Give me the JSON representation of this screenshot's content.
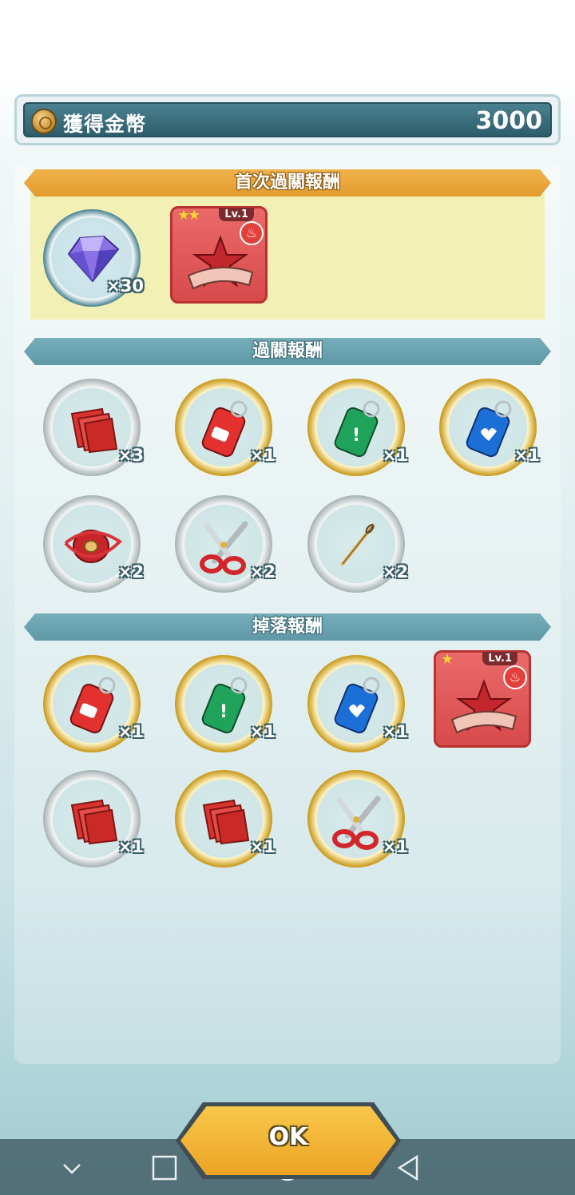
{
  "coin_bar": {
    "label": "獲得金幣",
    "value": "3000",
    "icon": "coin-icon"
  },
  "sections": {
    "first_clear": {
      "title": "首次過關報酬"
    },
    "clear": {
      "title": "過關報酬"
    },
    "drop": {
      "title": "掉落報酬"
    }
  },
  "first_clear_items": [
    {
      "icon": "diamond-icon",
      "qty": "×30"
    },
    {
      "icon": "red-star-scarf-card-icon",
      "stars": "★★",
      "level": "Lv.1"
    }
  ],
  "clear_items": [
    {
      "icon": "red-cloth-icon",
      "qty": "×3"
    },
    {
      "icon": "red-bottle-icon",
      "qty": "×1"
    },
    {
      "icon": "green-bottle-icon",
      "qty": "×1"
    },
    {
      "icon": "blue-bottle-icon",
      "qty": "×1"
    },
    {
      "icon": "thread-spool-icon",
      "qty": "×2"
    },
    {
      "icon": "scissors-icon",
      "qty": "×2"
    },
    {
      "icon": "needle-icon",
      "qty": "×2"
    }
  ],
  "drop_items": [
    {
      "icon": "red-bottle-icon",
      "qty": "×1"
    },
    {
      "icon": "green-bottle-icon",
      "qty": "×1"
    },
    {
      "icon": "blue-bottle-icon",
      "qty": "×1"
    },
    {
      "icon": "red-star-scarf-card-icon",
      "stars": "★",
      "level": "Lv.1"
    },
    {
      "icon": "red-cloth-icon",
      "qty": "×1"
    },
    {
      "icon": "red-cloth-icon",
      "qty": "×1"
    },
    {
      "icon": "scissors-icon",
      "qty": "×1"
    }
  ],
  "ok_button": {
    "label": "OK"
  },
  "nav": {
    "icons": [
      "nav-down-icon",
      "recent-apps-icon",
      "home-icon",
      "back-icon"
    ]
  },
  "colors": {
    "gold_ring": "#c99a1d",
    "teal_banner": "#6aa4b2",
    "orange_banner": "#e9a63a",
    "card_red": "#e05a5a"
  }
}
